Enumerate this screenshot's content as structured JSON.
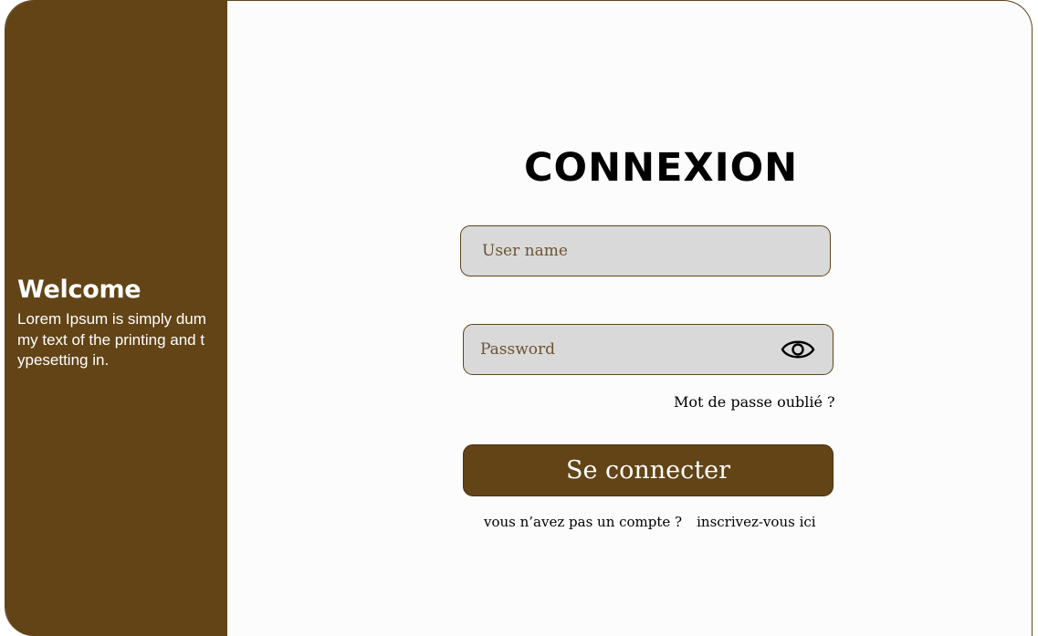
{
  "sidebar": {
    "title": "Welcome",
    "text": "Lorem Ipsum is simply dummy text of the printing and typesetting in."
  },
  "login": {
    "title": "CONNEXION",
    "username_placeholder": "User name",
    "password_placeholder": "Password",
    "forgot_label": "Mot de passe oublié ?",
    "submit_label": "Se connecter",
    "no_account_label": "vous n’avez pas un compte ?",
    "signup_label": "inscrivez-vous ici"
  },
  "icons": {
    "password_toggle": "eye-icon"
  },
  "colors": {
    "brand_brown": "#624416",
    "field_bg": "#d9d9d9",
    "page_bg": "#fcfcfc"
  }
}
